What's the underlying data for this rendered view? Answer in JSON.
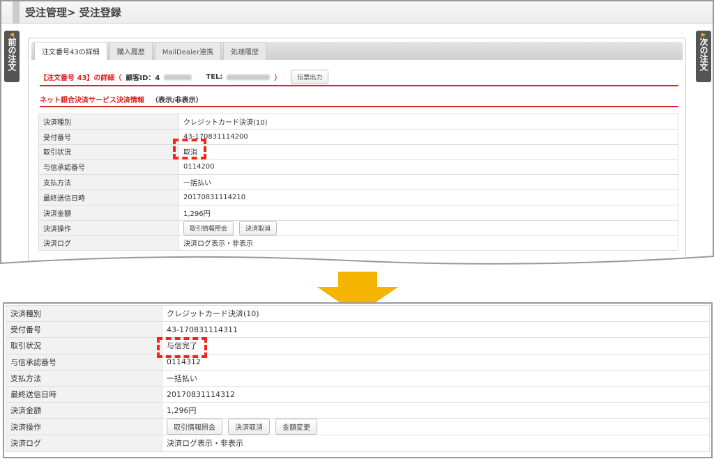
{
  "page": {
    "title": "受注管理> 受注登録",
    "prev_order": "前の注文",
    "next_order": "次の注文"
  },
  "tabs": [
    "注文番号43の詳細",
    "購入履歴",
    "MailDealer連携",
    "処理履歴"
  ],
  "header": {
    "order_title": "【注文番号 43】の詳細（",
    "customer_id_label": "顧客ID：4",
    "tel_label": "TEL:",
    "close_paren": "）",
    "slip_button": "伝票出力"
  },
  "section": {
    "title": "ネット銀合決済サービス決済情報",
    "toggle": "（表示/非表示）"
  },
  "before": {
    "rows": [
      {
        "label": "決済種別",
        "value": "クレジットカード決済(10)"
      },
      {
        "label": "受付番号",
        "value": "43-170831114200"
      },
      {
        "label": "取引状況",
        "value": "取消"
      },
      {
        "label": "与信承認番号",
        "value": "0114200"
      },
      {
        "label": "支払方法",
        "value": "一括払い"
      },
      {
        "label": "最終送信日時",
        "value": "20170831114210"
      },
      {
        "label": "決済金額",
        "value": "1,296円"
      },
      {
        "label": "決済操作",
        "buttons": [
          "取引情報照会",
          "決済取消"
        ]
      },
      {
        "label": "決済ログ",
        "value": "決済ログ表示・非表示"
      }
    ]
  },
  "after": {
    "rows": [
      {
        "label": "決済種別",
        "value": "クレジットカード決済(10)"
      },
      {
        "label": "受付番号",
        "value": "43-170831114311"
      },
      {
        "label": "取引状況",
        "value": "与信完了"
      },
      {
        "label": "与信承認番号",
        "value": "0114312"
      },
      {
        "label": "支払方法",
        "value": "一括払い"
      },
      {
        "label": "最終送信日時",
        "value": "20170831114312"
      },
      {
        "label": "決済金額",
        "value": "1,296円"
      },
      {
        "label": "決済操作",
        "buttons": [
          "取引情報照会",
          "決済取消",
          "金額変更"
        ]
      },
      {
        "label": "決済ログ",
        "value": "決済ログ表示・非表示"
      }
    ]
  }
}
